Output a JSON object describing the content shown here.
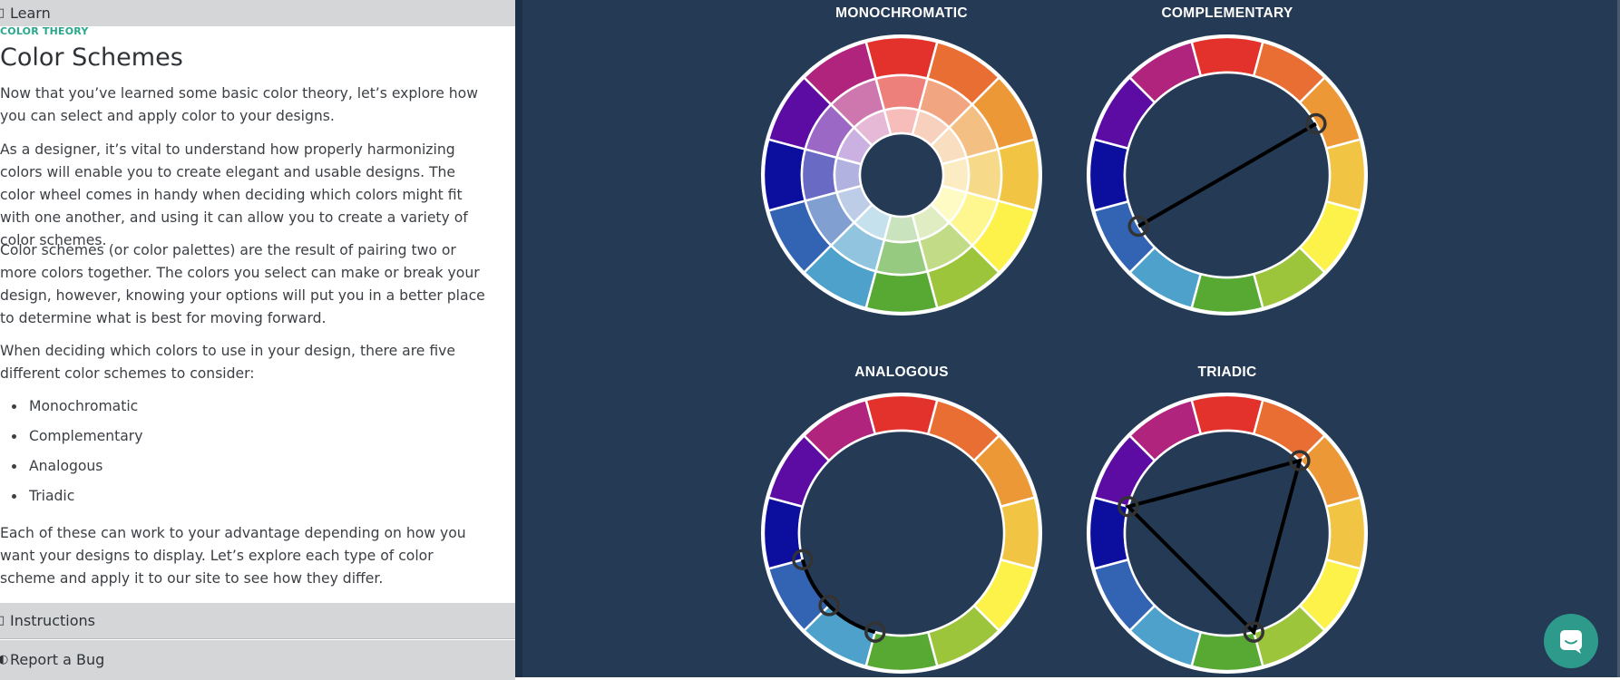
{
  "sidebar": {
    "top_accordion": {
      "label": "Learn",
      "icon": "expand-icon"
    },
    "eyebrow": "COLOR THEORY",
    "title": "Color Schemes",
    "paragraphs": [
      "Now that you’ve learned some basic color theory, let’s explore how you can select and apply color to your designs.",
      "As a designer, it’s vital to understand how properly harmonizing colors will enable you to create elegant and usable designs. The color wheel comes in handy when deciding which colors might fit with one another, and using it can allow you to create a variety of color schemes.",
      "Color schemes (or color palettes) are the result of pairing two or more colors together. The colors you select can make or break your design, however, knowing your options will put you in a better place to determine what is best for moving forward.",
      "When deciding which colors to use in your design, there are five different color schemes to consider:",
      "Each of these can work to your advantage depending on how you want your designs to display. Let’s explore each type of color scheme and apply it to our site to see how they differ."
    ],
    "schemes": [
      "Monochromatic",
      "Complementary",
      "Analogous",
      "Triadic"
    ],
    "bottom_accordions": [
      {
        "label": "Instructions",
        "icon": "expand-icon"
      },
      {
        "label": "Report a Bug",
        "icon": "bug-icon"
      }
    ]
  },
  "diagram": {
    "wheel_colors": [
      "#e3322b",
      "#e86e33",
      "#ed9837",
      "#f1c443",
      "#fdf24a",
      "#9dc53c",
      "#57a933",
      "#4ea1cb",
      "#3364b4",
      "#0c0e9e",
      "#5d0ca3",
      "#b0247e"
    ],
    "background": "#253b55",
    "wheels": [
      {
        "id": "mono",
        "label": "MONOCHROMATIC",
        "type": "monochromatic"
      },
      {
        "id": "comp",
        "label": "COMPLEMENTARY",
        "type": "complementary",
        "markers": [
          2,
          8
        ]
      },
      {
        "id": "analog",
        "label": "ANALOGOUS",
        "type": "analogous",
        "markers": [
          6.5,
          7.5,
          8.5
        ]
      },
      {
        "id": "triad",
        "label": "TRIADIC",
        "type": "triadic",
        "markers": [
          1.5,
          5.5,
          9.5
        ]
      }
    ]
  },
  "chat": {
    "icon": "chat-icon"
  }
}
